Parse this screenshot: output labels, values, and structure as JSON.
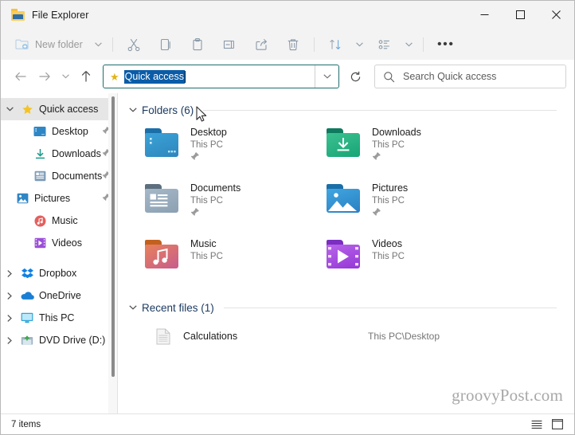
{
  "window": {
    "title": "File Explorer",
    "icon": "folder-icon",
    "controls": {
      "minimize": "—",
      "maximize": "□",
      "close": "✕"
    }
  },
  "toolbar": {
    "new_folder_label": "New folder",
    "new_folder_chevron": "⌄",
    "buttons": [
      {
        "name": "cut-button",
        "label": "Cut"
      },
      {
        "name": "copy-button",
        "label": "Copy"
      },
      {
        "name": "paste-button",
        "label": "Paste"
      },
      {
        "name": "rename-button",
        "label": "Rename"
      },
      {
        "name": "share-button",
        "label": "Share"
      },
      {
        "name": "delete-button",
        "label": "Delete"
      },
      {
        "name": "sort-button",
        "label": "Sort"
      },
      {
        "name": "view-button",
        "label": "View"
      },
      {
        "name": "more-button",
        "label": "•••"
      }
    ]
  },
  "address_bar": {
    "back_label": "Back",
    "forward_label": "Forward",
    "recent_label": "Recent locations",
    "up_label": "Up",
    "star_icon": "★",
    "path_text": "Quick access",
    "path_selected": true,
    "dropdown_icon": "⌄",
    "refresh_label": "Refresh"
  },
  "search": {
    "placeholder": "Search Quick access",
    "icon": "search-icon"
  },
  "sidebar": {
    "items": [
      {
        "label": "Quick access",
        "icon": "star-icon",
        "expandable": true,
        "expanded": true,
        "selected": true,
        "pinned": false,
        "child": false
      },
      {
        "label": "Desktop",
        "icon": "desktop-icon",
        "expandable": false,
        "expanded": false,
        "selected": false,
        "pinned": true,
        "child": true
      },
      {
        "label": "Downloads",
        "icon": "downloads-icon",
        "expandable": false,
        "expanded": false,
        "selected": false,
        "pinned": true,
        "child": true
      },
      {
        "label": "Documents",
        "icon": "documents-icon",
        "expandable": false,
        "expanded": false,
        "selected": false,
        "pinned": true,
        "child": true
      },
      {
        "label": "Pictures",
        "icon": "pictures-icon",
        "expandable": false,
        "expanded": false,
        "selected": false,
        "pinned": true,
        "child": true
      },
      {
        "label": "Music",
        "icon": "music-icon",
        "expandable": false,
        "expanded": false,
        "selected": false,
        "pinned": false,
        "child": true
      },
      {
        "label": "Videos",
        "icon": "videos-icon",
        "expandable": false,
        "expanded": false,
        "selected": false,
        "pinned": false,
        "child": true
      },
      {
        "label": "Dropbox",
        "icon": "dropbox-icon",
        "expandable": true,
        "expanded": false,
        "selected": false,
        "pinned": false,
        "child": false
      },
      {
        "label": "OneDrive",
        "icon": "onedrive-icon",
        "expandable": true,
        "expanded": false,
        "selected": false,
        "pinned": false,
        "child": false
      },
      {
        "label": "This PC",
        "icon": "pc-icon",
        "expandable": true,
        "expanded": false,
        "selected": false,
        "pinned": false,
        "child": false
      },
      {
        "label": "DVD Drive (D:) C",
        "icon": "dvd-icon",
        "expandable": true,
        "expanded": false,
        "selected": false,
        "pinned": false,
        "child": false
      }
    ]
  },
  "content": {
    "folders_group": {
      "title": "Folders (6)",
      "chevron": "⌄",
      "items": [
        {
          "name": "Desktop",
          "location": "This PC",
          "pinned": true,
          "icon": "desktop-folder-icon"
        },
        {
          "name": "Downloads",
          "location": "This PC",
          "pinned": true,
          "icon": "downloads-folder-icon"
        },
        {
          "name": "Documents",
          "location": "This PC",
          "pinned": true,
          "icon": "documents-folder-icon"
        },
        {
          "name": "Pictures",
          "location": "This PC",
          "pinned": true,
          "icon": "pictures-folder-icon"
        },
        {
          "name": "Music",
          "location": "This PC",
          "pinned": false,
          "icon": "music-folder-icon"
        },
        {
          "name": "Videos",
          "location": "This PC",
          "pinned": false,
          "icon": "videos-folder-icon"
        }
      ]
    },
    "recent_group": {
      "title": "Recent files (1)",
      "chevron": "⌄",
      "items": [
        {
          "name": "Calculations",
          "path": "This PC\\Desktop",
          "icon": "document-icon"
        }
      ]
    },
    "watermark": "groovyPost.com"
  },
  "status_bar": {
    "item_count": "7 items",
    "details_view_label": "Details view",
    "large_icons_view_label": "Large icons view"
  },
  "colors": {
    "accent": "#0a5ca8",
    "address_border": "#1f6e6e",
    "group_title": "#1c3b63",
    "star": "#e0b41c",
    "chrome": "#f3f3f3"
  }
}
